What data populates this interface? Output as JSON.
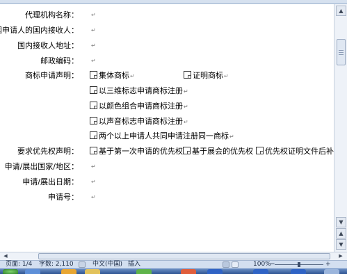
{
  "form": {
    "rows": [
      {
        "label": "代理机构名称："
      },
      {
        "label": "一国申请人的国内接收人："
      },
      {
        "label": "国内接收人地址："
      },
      {
        "label": "邮政编码："
      },
      {
        "label": "商标申请声明："
      },
      {
        "label": ""
      },
      {
        "label": ""
      },
      {
        "label": ""
      },
      {
        "label": ""
      },
      {
        "label": "要求优先权声明："
      },
      {
        "label": "申请/展出国家/地区："
      },
      {
        "label": "申请/展出日期："
      },
      {
        "label": "申请号："
      }
    ],
    "trademark_declaration": {
      "collective": "集体商标",
      "certification": "证明商标",
      "three_dimensional": "以三维标志申请商标注册",
      "color_combination": "以颜色组合申请商标注册",
      "sound": "以声音标志申请商标注册",
      "joint_applicants": "两个以上申请人共同申请注册同一商标"
    },
    "priority_declaration": {
      "first_application": "基于第一次申请的优先权",
      "exhibition": "基于展会的优先权",
      "documents_later": "优先权证明文件后补"
    },
    "paragraph_mark": "↵"
  },
  "statusbar": {
    "page": "页面: 1/4",
    "words": "字数: 2,110",
    "language": "中文(中国)",
    "mode": "插入",
    "zoom": "100%",
    "zoom_level": 1.0
  },
  "icons": {
    "vscroll_up": "▲",
    "vscroll_down": "▼",
    "hscroll_left": "◀",
    "hscroll_right": "▶",
    "prev_page": "▲",
    "next_page": "▼",
    "zoom_minus": "−",
    "zoom_plus": "+"
  }
}
